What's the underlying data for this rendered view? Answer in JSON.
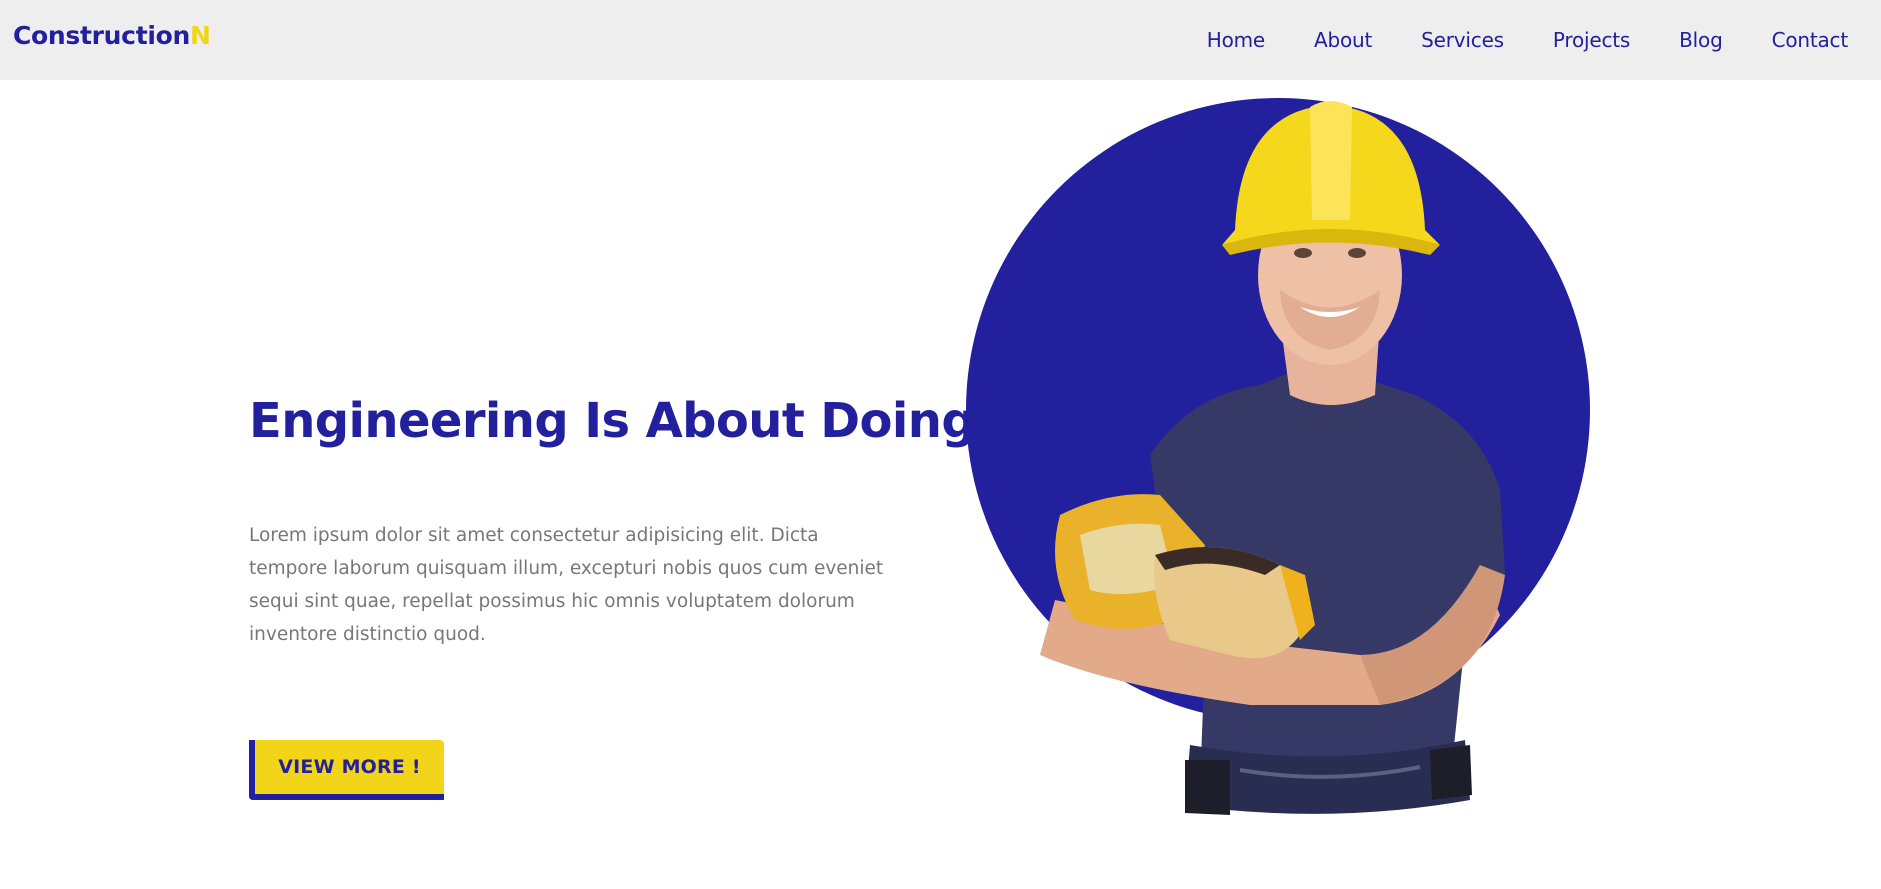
{
  "brand": {
    "name": "Construction",
    "accent": "N"
  },
  "nav": {
    "items": [
      {
        "label": "Home"
      },
      {
        "label": "About"
      },
      {
        "label": "Services"
      },
      {
        "label": "Projects"
      },
      {
        "label": "Blog"
      },
      {
        "label": "Contact"
      }
    ]
  },
  "hero": {
    "title": "Engineering Is About Doing",
    "text": "Lorem ipsum dolor sit amet consectetur adipisicing elit. Dicta tempore laborum quisquam illum, excepturi nobis quos cum eveniet sequi sint quae, repellat possimus hic omnis voluptatem dolorum inventore distinctio quod.",
    "cta_label": "VIEW MORE !",
    "image_icon": "construction-worker-illustration"
  },
  "colors": {
    "primary": "#22209c",
    "accent": "#f2d519",
    "nav_bg": "#eeeeee",
    "body_text": "#777777"
  }
}
